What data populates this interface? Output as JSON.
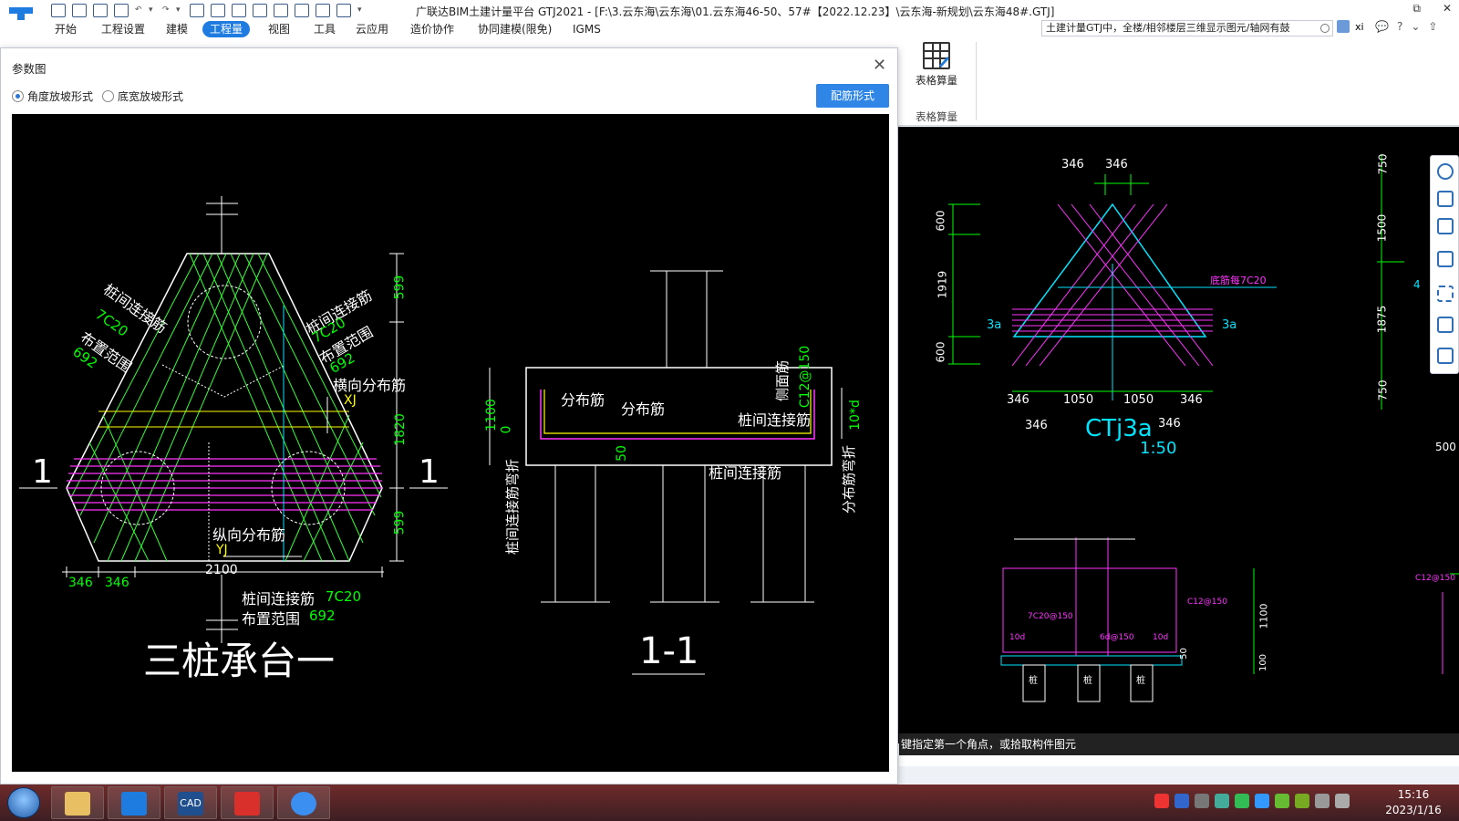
{
  "app": {
    "title": "广联达BIM土建计量平台 GTJ2021 - [F:\\3.云东海\\云东海\\01.云东海46-50、57#【2022.12.23】\\云东海-新规划\\云东海48#.GTJ]",
    "window_controls": [
      "⧉",
      "✕"
    ]
  },
  "menu": {
    "items": [
      "开始",
      "工程设置",
      "建模",
      "工程量",
      "视图",
      "工具",
      "云应用",
      "造价协作",
      "协同建模(限免)",
      "IGMS"
    ],
    "active_index": 3
  },
  "search": {
    "value": "土建计量GTJ中，全楼/相邻楼层三维显示图元/轴网有鼓"
  },
  "user": {
    "name": "xi"
  },
  "help_icons": [
    "💬",
    "?",
    "⌄",
    "⇧"
  ],
  "ribbon": {
    "table_calc_label": "表格算量",
    "table_calc_group": "表格算量"
  },
  "dialog": {
    "title": "参数图",
    "close": "✕",
    "radio_options": [
      "角度放坡形式",
      "底宽放坡形式"
    ],
    "radio_selected": 0,
    "config_button": "配筋形式"
  },
  "diagram_text": {
    "plan_title": "三桩承台一",
    "section_title": "1-1",
    "section_mark": "1",
    "tie_bar": "桩间连接筋",
    "tie_bar_spec": "7C20",
    "layout_range": "布置范围",
    "layout_value": "692",
    "transverse_bar": "横向分布筋",
    "longitudinal_bar": "纵向分布筋",
    "xj": "XJ",
    "yj": "YJ",
    "dim_599": "599",
    "dim_1820": "1820",
    "dim_2100": "2100",
    "dim_346": "346",
    "dist_bar": "分布筋",
    "side_bar": "侧面筋",
    "side_bar_spec": "C12@150",
    "dim_1100": "1100",
    "dim_0": "0",
    "dim_50": "50",
    "dim_10d": "10*d",
    "tie_bend": "桩间连接筋弯折",
    "dist_bend": "分布筋弯折"
  },
  "cad_text": {
    "d346": "346",
    "d1050": "1050",
    "d600": "600",
    "d1919": "1919",
    "d750": "750",
    "d1500": "1500",
    "d1875": "1875",
    "d500": "500",
    "d4": "4",
    "label_3a": "3a",
    "ctj": "CTj3a",
    "scale": "1:50",
    "bottom_bar": "底筋每7C20",
    "d1100": "1100",
    "d100": "100",
    "d50": "50",
    "c12": "C12@150",
    "c7": "7C20@150",
    "c6": "6d@150",
    "d10d": "10d",
    "pile": "桩"
  },
  "status": {
    "prompt": "键指定第一个角点，或拾取构件图元"
  },
  "clock": {
    "time": "15:16",
    "date": "2023/1/16"
  },
  "taskbar": {
    "cad_label": "CAD"
  },
  "colors": {
    "accent": "#1e7be0",
    "button": "#2f86e6",
    "cad_green": "#00ff00",
    "cad_magenta": "#ff00ff",
    "cad_cyan": "#00e5ff",
    "cad_yellow": "#ffff00"
  }
}
